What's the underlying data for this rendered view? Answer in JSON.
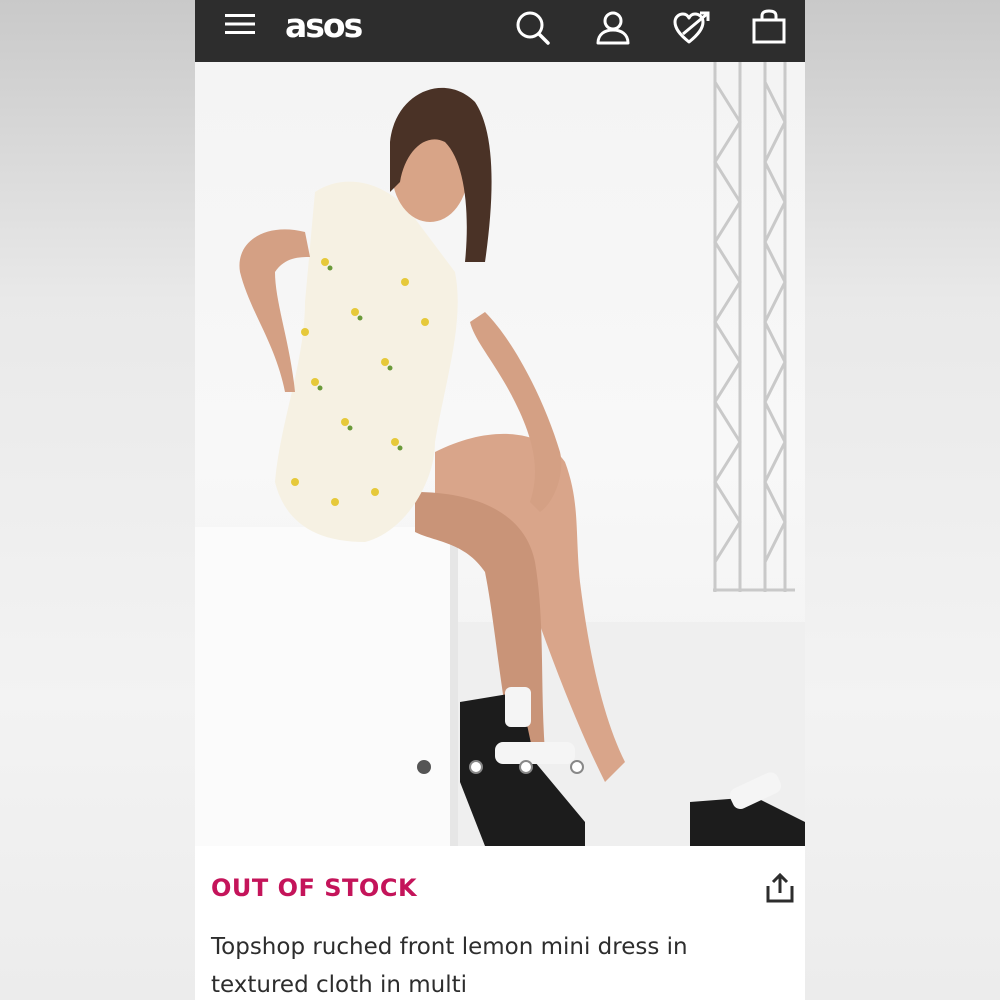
{
  "header": {
    "brand": "asos",
    "menu_icon": "hamburger-menu-icon",
    "search_icon": "search-icon",
    "account_icon": "user-icon",
    "saved_icon": "heart-icon",
    "bag_icon": "shopping-bag-icon",
    "background_color": "#2d2d2d"
  },
  "gallery": {
    "image_description_icon": "product-photo",
    "dot_count": 4,
    "active_index": 0
  },
  "product": {
    "status": "OUT OF STOCK",
    "status_color": "#c4145a",
    "title_line1": "Topshop ruched front lemon mini dress in",
    "title_line2": "textured cloth in multi",
    "share_icon": "share-icon"
  }
}
